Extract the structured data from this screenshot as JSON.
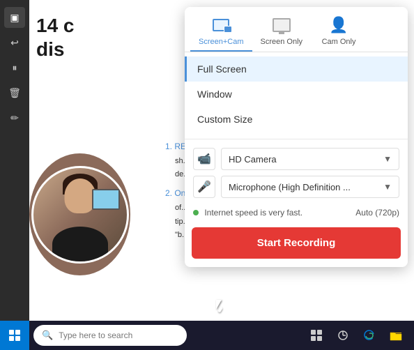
{
  "toolbar": {
    "buttons": [
      "▣",
      "↩",
      "⏸",
      "🗑",
      "✏"
    ]
  },
  "background": {
    "title_line1": "14 c",
    "title_line2": "dis"
  },
  "popup": {
    "tabs": [
      {
        "id": "screen-cam",
        "label": "Screen+Cam",
        "active": true
      },
      {
        "id": "screen-only",
        "label": "Screen Only",
        "active": false
      },
      {
        "id": "cam-only",
        "label": "Cam Only",
        "active": false
      }
    ],
    "options": [
      {
        "id": "full-screen",
        "label": "Full Screen",
        "selected": true
      },
      {
        "id": "window",
        "label": "Window",
        "selected": false
      },
      {
        "id": "custom-size",
        "label": "Custom Size",
        "selected": false
      }
    ],
    "camera": {
      "label": "HD Camera",
      "placeholder": "HD Camera"
    },
    "microphone": {
      "label": "Microphone (High Definition ...",
      "placeholder": "Microphone (High Definition ..."
    },
    "status": {
      "text": "Internet speed is very fast.",
      "quality": "Auto (720p)"
    },
    "record_button": "Start Recording"
  },
  "taskbar": {
    "search_placeholder": "Type here to search",
    "icons": [
      "🔍",
      "⊞",
      "◯",
      "⊡",
      "🌐",
      "📁"
    ]
  }
}
